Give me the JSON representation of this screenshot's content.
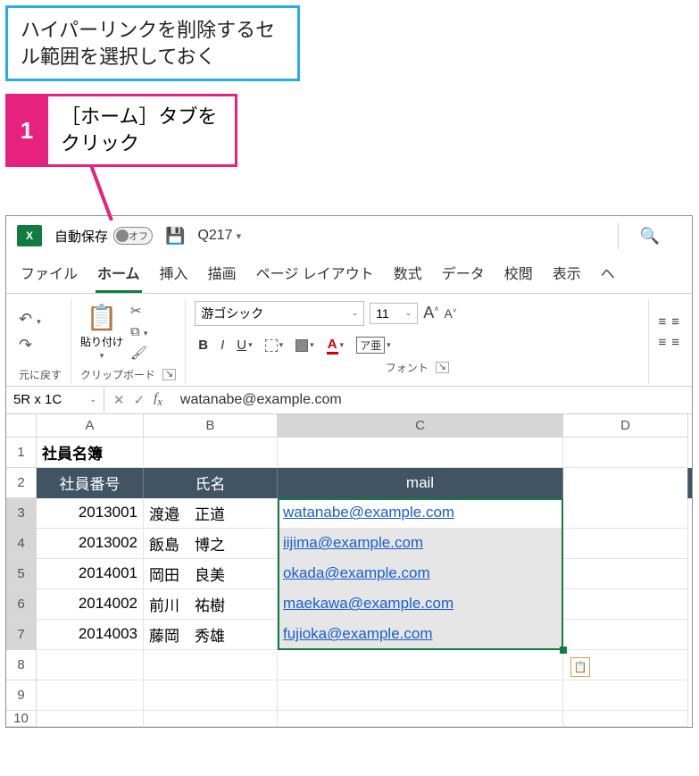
{
  "callouts": {
    "preselect": "ハイパーリンクを削除するセル範囲を選択しておく",
    "step1_num": "1",
    "step1_text": "［ホーム］タブをクリック"
  },
  "titlebar": {
    "autosave_label": "自動保存",
    "autosave_state": "オフ",
    "doc_name": "Q217"
  },
  "tabs": {
    "file": "ファイル",
    "home": "ホーム",
    "insert": "挿入",
    "draw": "描画",
    "pagelayout": "ページ レイアウト",
    "formulas": "数式",
    "data": "データ",
    "review": "校閲",
    "view": "表示",
    "help_initial": "ヘ"
  },
  "ribbon": {
    "undo_group": "元に戻す",
    "paste_label": "貼り付け",
    "clipboard_group": "クリップボード",
    "font_name": "游ゴシック",
    "font_size": "11",
    "font_group": "フォント",
    "bold": "B",
    "italic": "I",
    "underline": "U",
    "fontcolor_letter": "A",
    "ime_letter": "ア亜"
  },
  "fx": {
    "namebox": "5R x 1C",
    "formula": "watanabe@example.com"
  },
  "sheet": {
    "cols": [
      "A",
      "B",
      "C",
      "D"
    ],
    "title": "社員名簿",
    "headers": {
      "id": "社員番号",
      "name": "氏名",
      "mail": "mail"
    },
    "rows": [
      {
        "id": "2013001",
        "name": "渡邉　正道",
        "mail": "watanabe@example.com"
      },
      {
        "id": "2013002",
        "name": "飯島　博之",
        "mail": "iijima@example.com"
      },
      {
        "id": "2014001",
        "name": "岡田　良美",
        "mail": "okada@example.com"
      },
      {
        "id": "2014002",
        "name": "前川　祐樹",
        "mail": "maekawa@example.com"
      },
      {
        "id": "2014003",
        "name": "藤岡　秀雄",
        "mail": "fujioka@example.com"
      }
    ],
    "row_numbers": [
      "1",
      "2",
      "3",
      "4",
      "5",
      "6",
      "7",
      "8",
      "9",
      "10"
    ]
  }
}
